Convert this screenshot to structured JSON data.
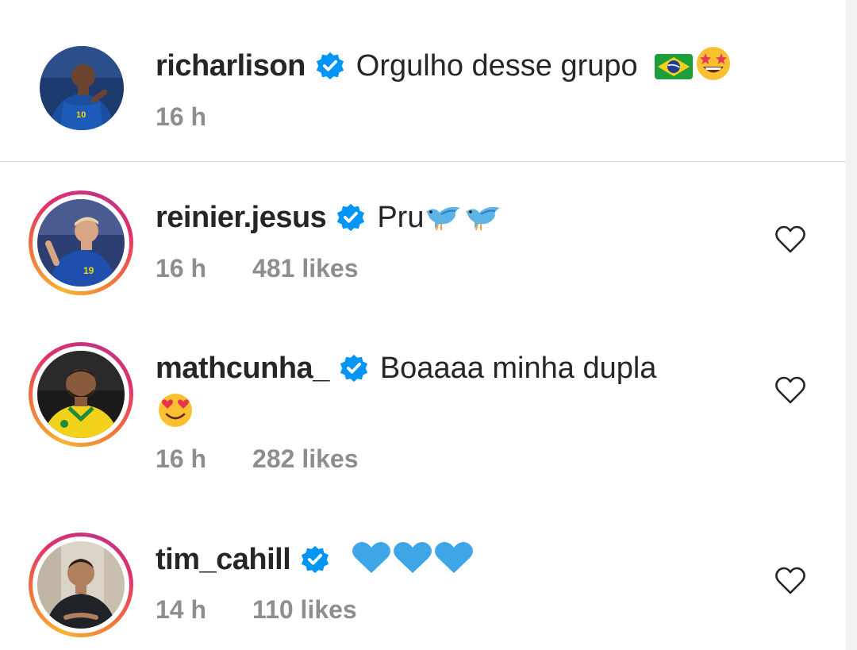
{
  "comments": [
    {
      "username": "richarlison",
      "text": "Orgulho desse grupo",
      "emojis": [
        "brazil-flag",
        "star-struck-face"
      ],
      "time": "16 h",
      "likes": "",
      "has_ring": false,
      "avatar": "player-blue-kit-10"
    },
    {
      "username": "reinier.jesus",
      "text": "Pru",
      "emojis": [
        "bird",
        "bird"
      ],
      "time": "16 h",
      "likes": "481 likes",
      "has_ring": true,
      "avatar": "player-blue-kit-19"
    },
    {
      "username": "mathcunha_",
      "text": "Boaaaa minha dupla",
      "emojis": [
        "heart-eyes-face"
      ],
      "time": "16 h",
      "likes": "282 likes",
      "has_ring": true,
      "avatar": "player-yellow-kit"
    },
    {
      "username": "tim_cahill",
      "text": "",
      "emojis": [
        "blue-heart",
        "blue-heart",
        "blue-heart"
      ],
      "time": "14 h",
      "likes": "110 likes",
      "has_ring": true,
      "avatar": "man-dark-shirt"
    }
  ],
  "colors": {
    "verified_badge": "#0095f6",
    "meta_text": "#8e8e8e",
    "blue_heart": "#3ea6e6"
  }
}
